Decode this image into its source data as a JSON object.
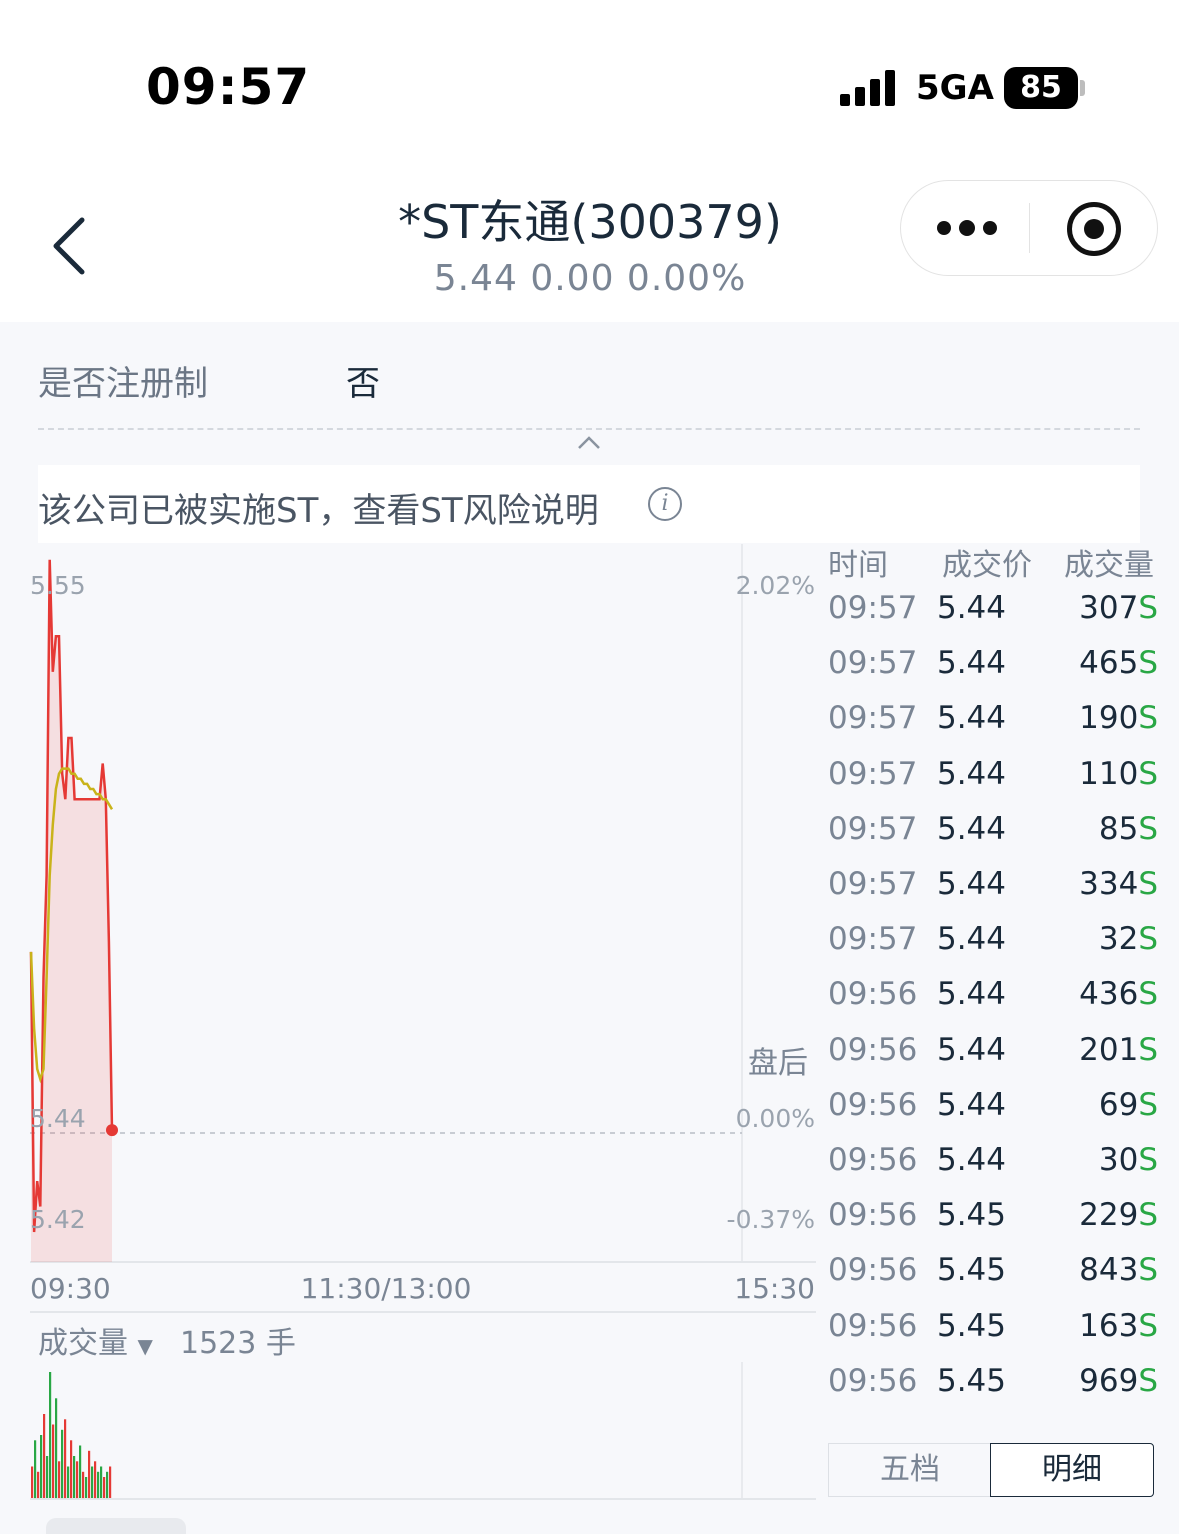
{
  "status_bar": {
    "time": "09:57",
    "network": "5GA",
    "battery": "85"
  },
  "header": {
    "title": "*ST东通(300379)",
    "price_line": "5.44  0.00  0.00%"
  },
  "info": {
    "row_label": "是否注册制",
    "row_value": "否",
    "st_notice": "该公司已被实施ST，查看ST风险说明",
    "info_icon_glyph": "i"
  },
  "chart": {
    "y_left_top": "5.55",
    "y_left_mid": "5.44",
    "y_left_bot": "5.42",
    "y_right_top": "2.02%",
    "y_right_mid": "0.00%",
    "y_right_bot": "-0.37%",
    "x_start": "09:30",
    "x_mid": "11:30/13:00",
    "x_end": "15:30",
    "after_hours": "盘后",
    "volume_label": "成交量",
    "volume_value": "1523 手",
    "line_color": "#e53935",
    "avg_color": "#c9b31a",
    "up_color": "#e53935",
    "down_color": "#29a745"
  },
  "chart_data": {
    "type": "line",
    "title": "",
    "xlabel": "",
    "ylabel": "",
    "ylim": [
      5.42,
      5.55
    ],
    "x_ticks": [
      "09:30",
      "11:30/13:00",
      "15:30"
    ],
    "series": [
      {
        "values": [
          5.475,
          5.42,
          5.43,
          5.425,
          5.47,
          5.49,
          5.552,
          5.53,
          5.537,
          5.537,
          5.51,
          5.505,
          5.517,
          5.517,
          5.505,
          5.505,
          5.505,
          5.505,
          5.505,
          5.505,
          5.505,
          5.505,
          5.505,
          5.512,
          5.505,
          5.477,
          5.44
        ]
      },
      {
        "values": [
          5.475,
          5.46,
          5.452,
          5.45,
          5.452,
          5.47,
          5.49,
          5.5,
          5.507,
          5.51,
          5.511,
          5.511,
          5.511,
          5.51,
          5.51,
          5.509,
          5.509,
          5.508,
          5.508,
          5.507,
          5.507,
          5.506,
          5.506,
          5.505,
          5.505,
          5.504,
          5.503
        ]
      }
    ],
    "volume": [
      30,
      55,
      25,
      60,
      80,
      40,
      120,
      70,
      95,
      35,
      65,
      75,
      30,
      55,
      40,
      35,
      50,
      25,
      20,
      45,
      30,
      35,
      25,
      30,
      20,
      25,
      30
    ],
    "volume_up": [
      true,
      false,
      true,
      false,
      true,
      false,
      false,
      true,
      false,
      true,
      false,
      true,
      false,
      true,
      false,
      true,
      false,
      true,
      false,
      true,
      false,
      true,
      false,
      false,
      true,
      false,
      true
    ]
  },
  "trades": {
    "headers": [
      "时间",
      "成交价",
      "成交量"
    ],
    "suffix": "S",
    "rows": [
      {
        "time": "09:57",
        "price": "5.44",
        "vol": "307"
      },
      {
        "time": "09:57",
        "price": "5.44",
        "vol": "465"
      },
      {
        "time": "09:57",
        "price": "5.44",
        "vol": "190"
      },
      {
        "time": "09:57",
        "price": "5.44",
        "vol": "110"
      },
      {
        "time": "09:57",
        "price": "5.44",
        "vol": "85"
      },
      {
        "time": "09:57",
        "price": "5.44",
        "vol": "334"
      },
      {
        "time": "09:57",
        "price": "5.44",
        "vol": "32"
      },
      {
        "time": "09:56",
        "price": "5.44",
        "vol": "436"
      },
      {
        "time": "09:56",
        "price": "5.44",
        "vol": "201"
      },
      {
        "time": "09:56",
        "price": "5.44",
        "vol": "69"
      },
      {
        "time": "09:56",
        "price": "5.44",
        "vol": "30"
      },
      {
        "time": "09:56",
        "price": "5.45",
        "vol": "229"
      },
      {
        "time": "09:56",
        "price": "5.45",
        "vol": "843"
      },
      {
        "time": "09:56",
        "price": "5.45",
        "vol": "163"
      },
      {
        "time": "09:56",
        "price": "5.45",
        "vol": "969"
      }
    ]
  },
  "tabs": {
    "tab1": "五档",
    "tab2": "明细"
  }
}
